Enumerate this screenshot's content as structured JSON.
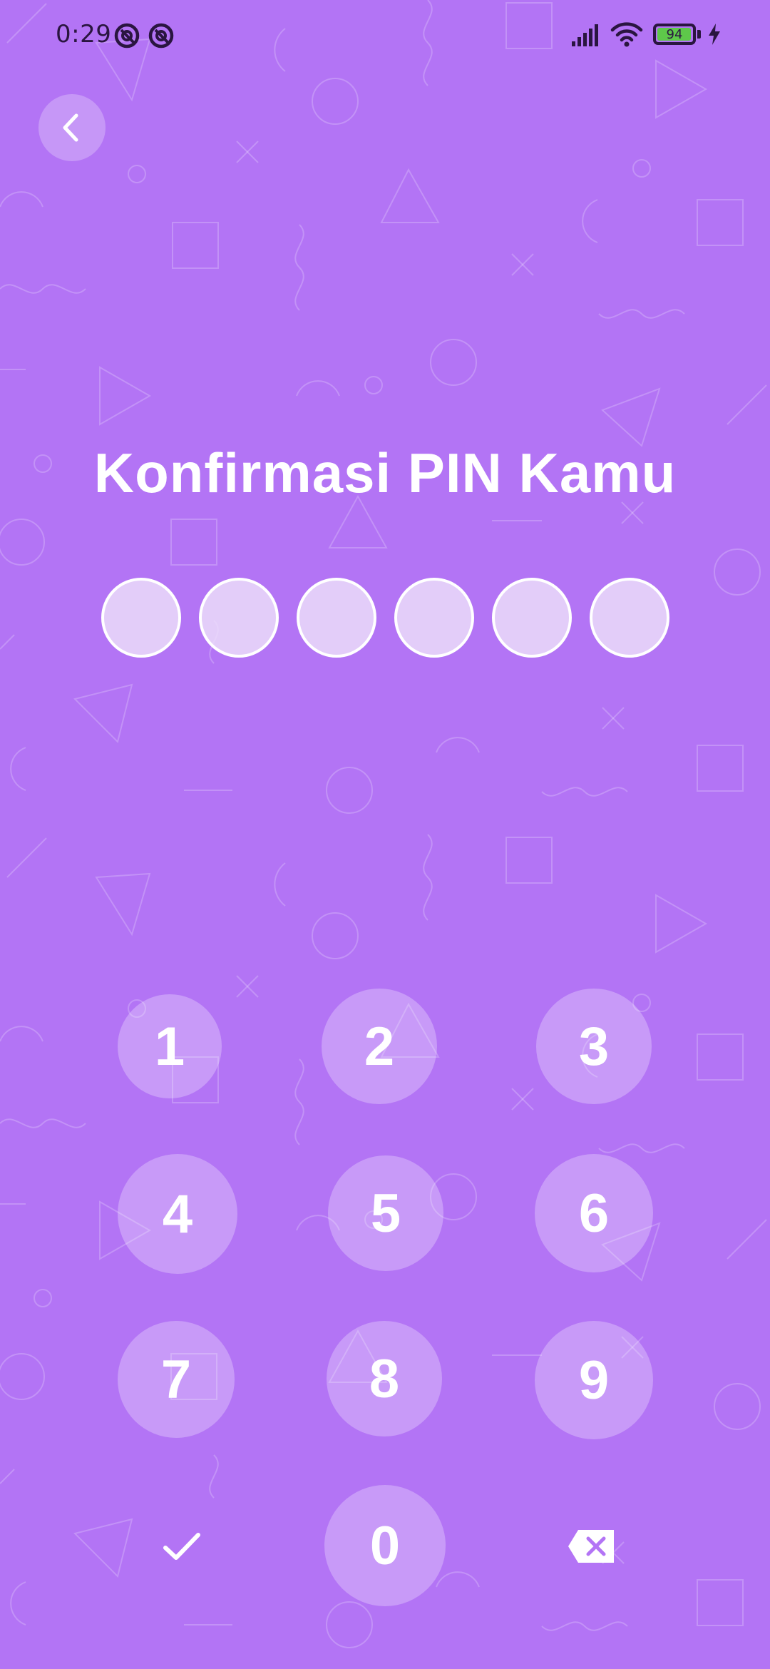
{
  "status_bar": {
    "time": "0:29",
    "battery_level": "94",
    "icons": [
      "notification-icon",
      "notification-icon",
      "signal-icon",
      "wifi-icon",
      "battery-icon",
      "charging-icon"
    ]
  },
  "header": {
    "back_icon": "chevron-left-icon"
  },
  "title": "Konfirmasi PIN Kamu",
  "pin": {
    "length": 6,
    "filled": 0
  },
  "keypad": {
    "keys": [
      "1",
      "2",
      "3",
      "4",
      "5",
      "6",
      "7",
      "8",
      "9",
      "0"
    ],
    "confirm_icon": "check-icon",
    "delete_icon": "backspace-icon"
  },
  "colors": {
    "background": "#b374f5",
    "text": "#ffffff",
    "battery": "#5ec84a"
  }
}
